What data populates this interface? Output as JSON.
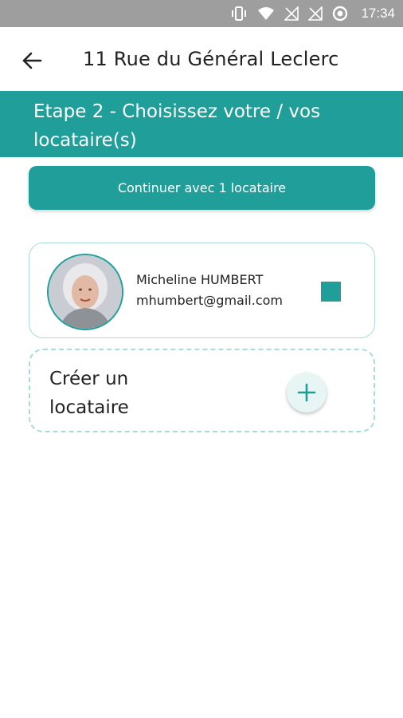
{
  "status_bar": {
    "time": "17:34"
  },
  "app_bar": {
    "title": "11 Rue du Général Leclerc"
  },
  "step": {
    "title": "Etape 2 - Choisissez votre / vos locataire(s)"
  },
  "continue_button": {
    "label": "Continuer avec 1 locataire"
  },
  "tenant": {
    "name": "Micheline HUMBERT",
    "email": "mhumbert@gmail.com",
    "selected": true
  },
  "create_tenant": {
    "label": "Créer un locataire"
  },
  "colors": {
    "accent": "#1f9e9a",
    "status_bar": "#9e9e9e",
    "card_border": "#a7dcd9"
  },
  "icons": {
    "vibrate": "vibrate-icon",
    "wifi": "wifi-icon",
    "signal1": "no-signal-icon",
    "signal2": "no-signal-icon",
    "sync": "sync-icon",
    "back": "arrow-left-icon",
    "add": "plus-icon"
  }
}
